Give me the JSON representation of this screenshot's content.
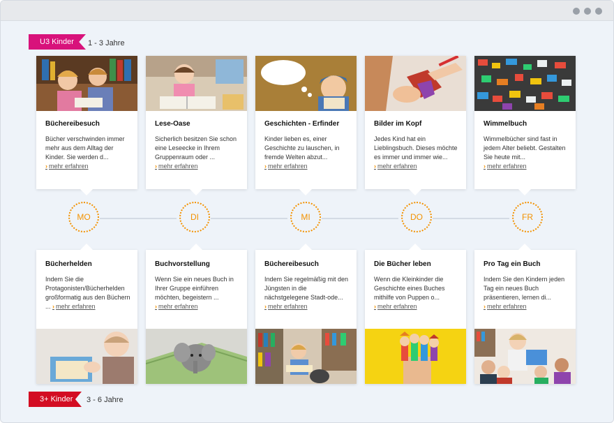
{
  "groups": {
    "u3": {
      "label": "U3 Kinder",
      "age": "1 - 3 Jahre"
    },
    "plus3": {
      "label": "3+ Kinder",
      "age": "3 - 6 Jahre"
    }
  },
  "more_label": "mehr erfahren",
  "days": [
    "MO",
    "DI",
    "MI",
    "DO",
    "FR"
  ],
  "top_cards": [
    {
      "title": "Büchereibesuch",
      "text": "Bücher verschwinden immer mehr aus dem Alltag der Kinder. Sie werden d...",
      "image": "children-reading-at-bookshelf"
    },
    {
      "title": "Lese-Oase",
      "text": "Sicherlich besitzen Sie schon eine Leseecke in Ihrem Gruppenraum oder ...",
      "image": "toddler-with-picture-books"
    },
    {
      "title": "Geschichten - Erfinder",
      "text": "Kinder lieben es, einer Geschichte zu lauschen, in fremde Welten abzut...",
      "image": "cartoon-boy-thought-bubble"
    },
    {
      "title": "Bilder im Kopf",
      "text": "Jedes Kind hat ein Lieblingsbuch. Dieses möchte es immer und immer wie...",
      "image": "child-painting"
    },
    {
      "title": "Wimmelbuch",
      "text": "Wimmelbücher sind fast in jedem Alter beliebt. Gestalten Sie heute mit...",
      "image": "colorful-toy-bricks"
    }
  ],
  "bottom_cards": [
    {
      "title": "Bücherhelden",
      "text": "Indem Sie die Protagonisten/Bücherhelden großformatig aus den Büchern ...",
      "image": "baby-with-book"
    },
    {
      "title": "Buchvorstellung",
      "text": "Wenn Sie ein neues Buch in Ihrer Gruppe einführen möchten, begeistern ...",
      "image": "plush-elephant-on-book"
    },
    {
      "title": "Büchereibesuch",
      "text": "Indem Sie regelmäßig mit den Jüngsten in die nächstgelegene Stadt-ode...",
      "image": "child-reading-in-library"
    },
    {
      "title": "Die Bücher leben",
      "text": "Wenn die Kleinkinder die Geschichte eines Buches mithilfe von Puppen o...",
      "image": "finger-puppets"
    },
    {
      "title": "Pro Tag ein Buch",
      "text": "Indem Sie den Kindern jeden Tag ein neues Buch präsentieren, lernen di...",
      "image": "teacher-reading-to-kids"
    }
  ],
  "colors": {
    "accent": "#f39200",
    "u3_tag": "#d8127b",
    "plus3_tag": "#d30d23"
  }
}
